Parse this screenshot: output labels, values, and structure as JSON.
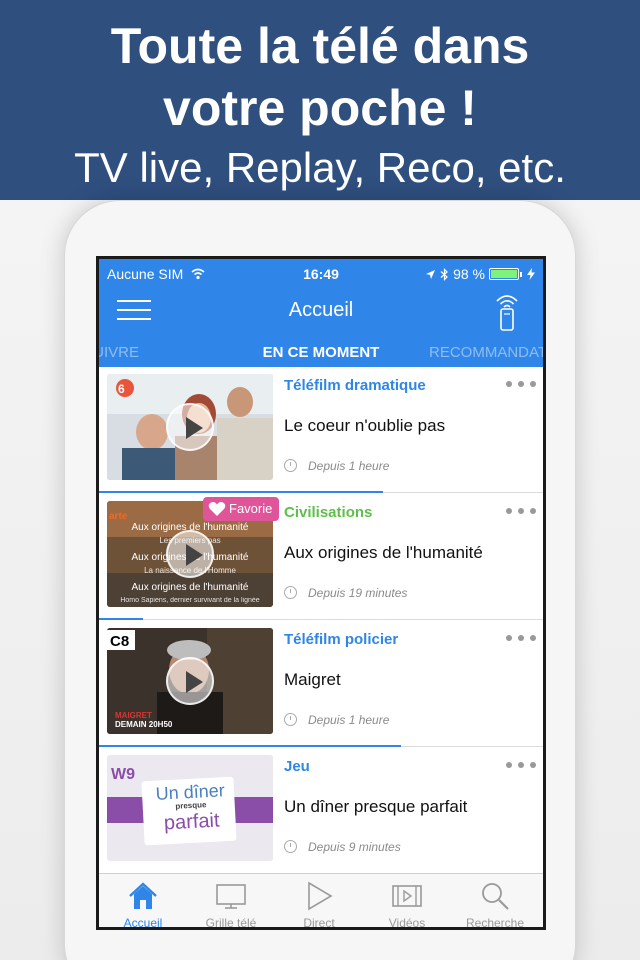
{
  "banner": {
    "headline_line1": "Toute la télé dans",
    "headline_line2": "votre poche !",
    "subtitle": "TV live, Replay, Reco, etc."
  },
  "status_bar": {
    "carrier": "Aucune SIM",
    "time": "16:49",
    "battery": "98 %"
  },
  "nav": {
    "title": "Accueil",
    "menu_icon": "hamburger-icon",
    "remote_icon": "remote-control-icon"
  },
  "tabs": {
    "previous": "À SUIVRE",
    "current": "EN CE MOMENT",
    "next": "RECOMMANDATIONS"
  },
  "colors": {
    "banner": "#2f4f7f",
    "header": "#2f86e8",
    "genre_blue": "#2f86e8",
    "genre_green": "#5fbf4a",
    "favorite": "#e0559a"
  },
  "programs": [
    {
      "genre": "Téléfilm dramatique",
      "genre_color": "#2f86e8",
      "title": "Le coeur n'oublie pas",
      "since": "Depuis 1 heure",
      "progress": 0.64,
      "channel": "M6",
      "favorite": false
    },
    {
      "genre": "Civilisations",
      "genre_color": "#5fbf4a",
      "title": "Aux origines de l'humanité",
      "since": "Depuis 19 minutes",
      "progress": 0.1,
      "channel": "arte",
      "favorite": true,
      "favorite_label": "Favorie"
    },
    {
      "genre": "Téléfilm policier",
      "genre_color": "#2f86e8",
      "title": "Maigret",
      "since": "Depuis 1 heure",
      "progress": 0.68,
      "channel": "C8",
      "favorite": false
    },
    {
      "genre": "Jeu",
      "genre_color": "#2f86e8",
      "title": "Un dîner presque parfait",
      "since": "Depuis 9 minutes",
      "progress": 0.0,
      "channel": "W9",
      "favorite": false
    }
  ],
  "thumbnails": {
    "arte_lines": [
      "Aux origines de l'humanité",
      "Les premiers pas",
      "Aux origines de l'humanité",
      "La naissance de l'Homme",
      "Aux origines de l'humanité",
      "Homo Sapiens, dernier survivant de la lignée"
    ],
    "maigret_caption": "MAIGRET",
    "maigret_time": "DEMAIN 20H50",
    "dinner_title_line1": "Un dîner",
    "dinner_title_line2": "presque",
    "dinner_title_line3": "parfait"
  },
  "tabbar": [
    {
      "label": "Accueil",
      "icon": "home-icon",
      "active": true
    },
    {
      "label": "Grille télé",
      "icon": "tv-grid-icon",
      "active": false
    },
    {
      "label": "Direct",
      "icon": "play-icon",
      "active": false
    },
    {
      "label": "Vidéos",
      "icon": "film-icon",
      "active": false
    },
    {
      "label": "Recherche",
      "icon": "search-icon",
      "active": false
    }
  ]
}
